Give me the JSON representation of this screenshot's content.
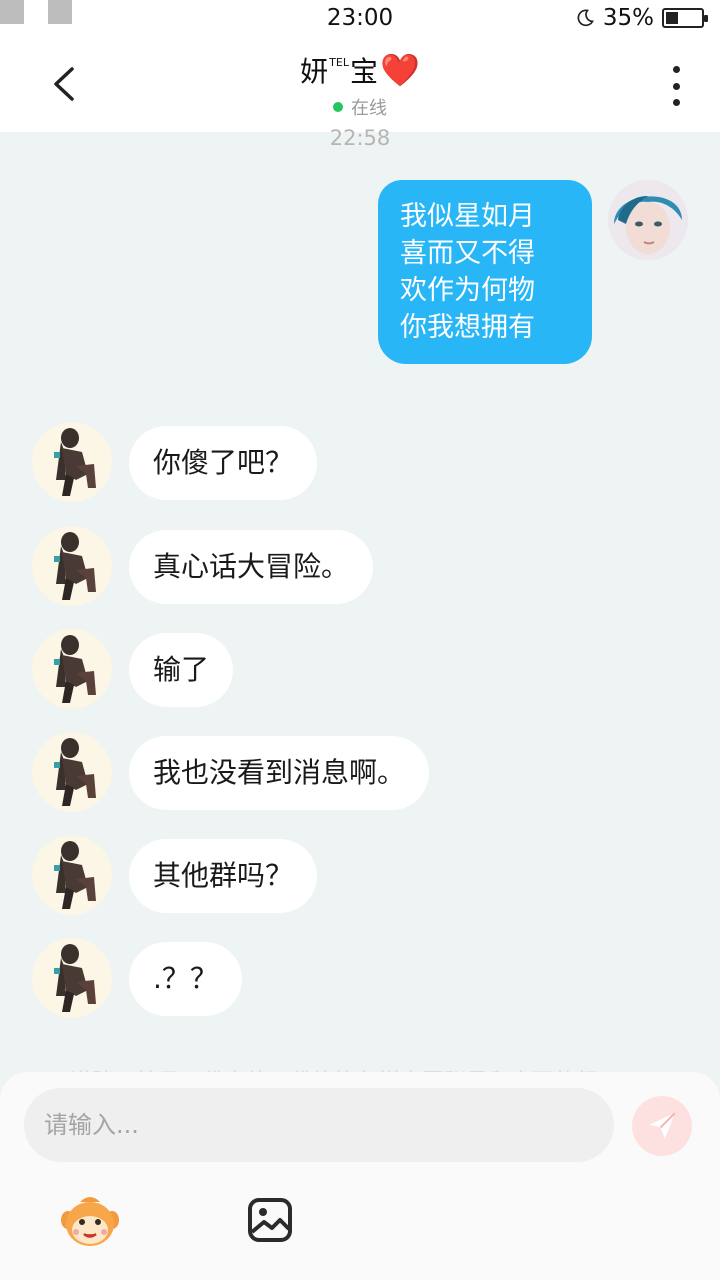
{
  "status_bar": {
    "time": "23:00",
    "battery_text": "35%",
    "battery_level": 0.35
  },
  "header": {
    "title_prefix": "妍",
    "title_sup": "TEL",
    "title_suffix": "宝",
    "title_emoji": "❤️",
    "status": "在线"
  },
  "chat": {
    "timestamp": "22:58",
    "outgoing": {
      "lines": [
        "我似星如月",
        "喜而又不得",
        "欢作为何物",
        "你我想拥有"
      ]
    },
    "incoming": [
      {
        "text": "你傻了吧？"
      },
      {
        "text": "真心话大冒险。"
      },
      {
        "text": "输了"
      },
      {
        "text": "我也没看到消息啊。"
      },
      {
        "text": "其他群吗？"
      },
      {
        "text": ".？？"
      }
    ],
    "faded_notice": "谨防以扶贝、代言值、代练等各样声要账号和密码的行"
  },
  "composer": {
    "placeholder": "请输入...",
    "value": ""
  },
  "icons": {
    "back": "chevron-left-icon",
    "more": "more-vertical-icon",
    "send": "send-icon",
    "emoji": "emoji-sticker-icon",
    "image": "image-icon"
  },
  "colors": {
    "outgoing_bubble": "#29b6f6",
    "background": "#eef3f3",
    "online_dot": "#22c55e",
    "send_button": "#fde1e1"
  }
}
